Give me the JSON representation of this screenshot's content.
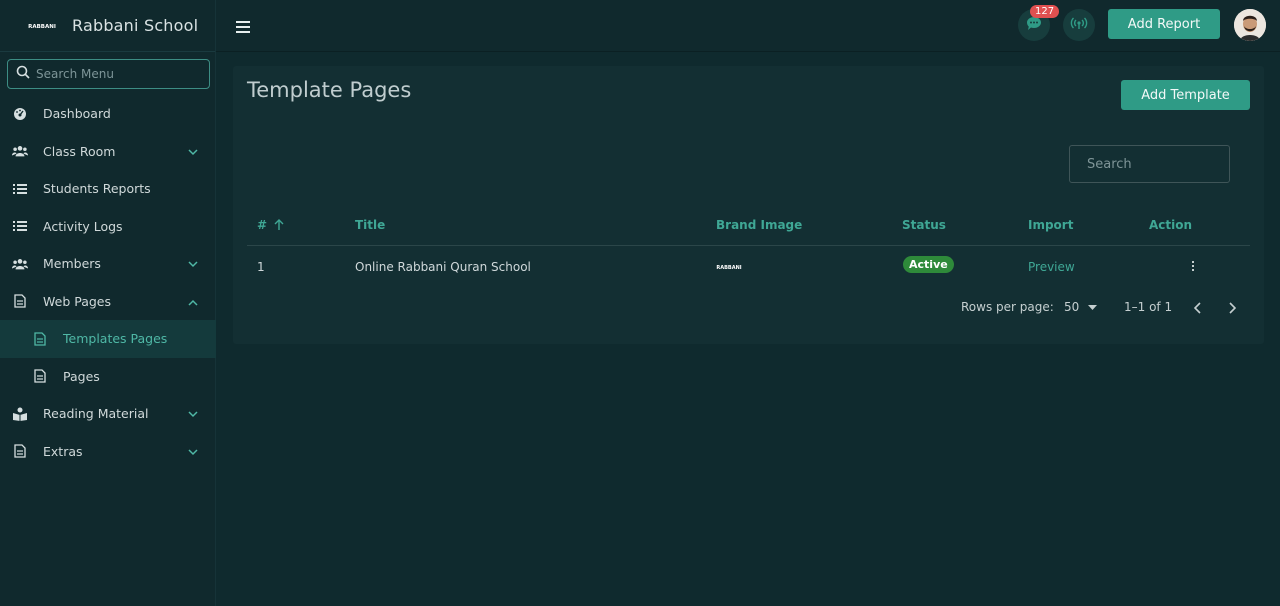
{
  "brand": {
    "name": "Rabbani School",
    "logo_text": "RABBANI"
  },
  "sidebar": {
    "search_placeholder": "Search Menu",
    "items": [
      {
        "label": "Dashboard",
        "icon": "dashboard-icon"
      },
      {
        "label": "Class Room",
        "icon": "users-icon"
      },
      {
        "label": "Students Reports",
        "icon": "list-icon"
      },
      {
        "label": "Activity Logs",
        "icon": "list-icon"
      },
      {
        "label": "Members",
        "icon": "users-icon"
      },
      {
        "label": "Web Pages",
        "icon": "document-icon"
      },
      {
        "label": "Templates Pages",
        "icon": "document-icon"
      },
      {
        "label": "Pages",
        "icon": "document-icon"
      },
      {
        "label": "Reading Material",
        "icon": "reader-icon"
      },
      {
        "label": "Extras",
        "icon": "document-icon"
      }
    ]
  },
  "topbar": {
    "chat_badge": "127",
    "add_report_label": "Add Report"
  },
  "main": {
    "title": "Template Pages",
    "add_template_label": "Add Template",
    "search_placeholder": "Search",
    "table": {
      "columns": [
        "#",
        "Title",
        "Brand Image",
        "Status",
        "Import",
        "Action"
      ],
      "rows": [
        {
          "num": "1",
          "title": "Online Rabbani Quran School",
          "brand_image": "RABBANI",
          "status": "Active",
          "import": "Preview"
        }
      ]
    },
    "pagination": {
      "rows_label": "Rows per page:",
      "rows_value": "50",
      "range": "1–1 of 1"
    }
  },
  "colors": {
    "accent": "#2f9b86",
    "accent_text": "#3fa795",
    "status_active": "#2e8a3a",
    "badge": "#e05050",
    "bg": "#0f2a2e"
  }
}
